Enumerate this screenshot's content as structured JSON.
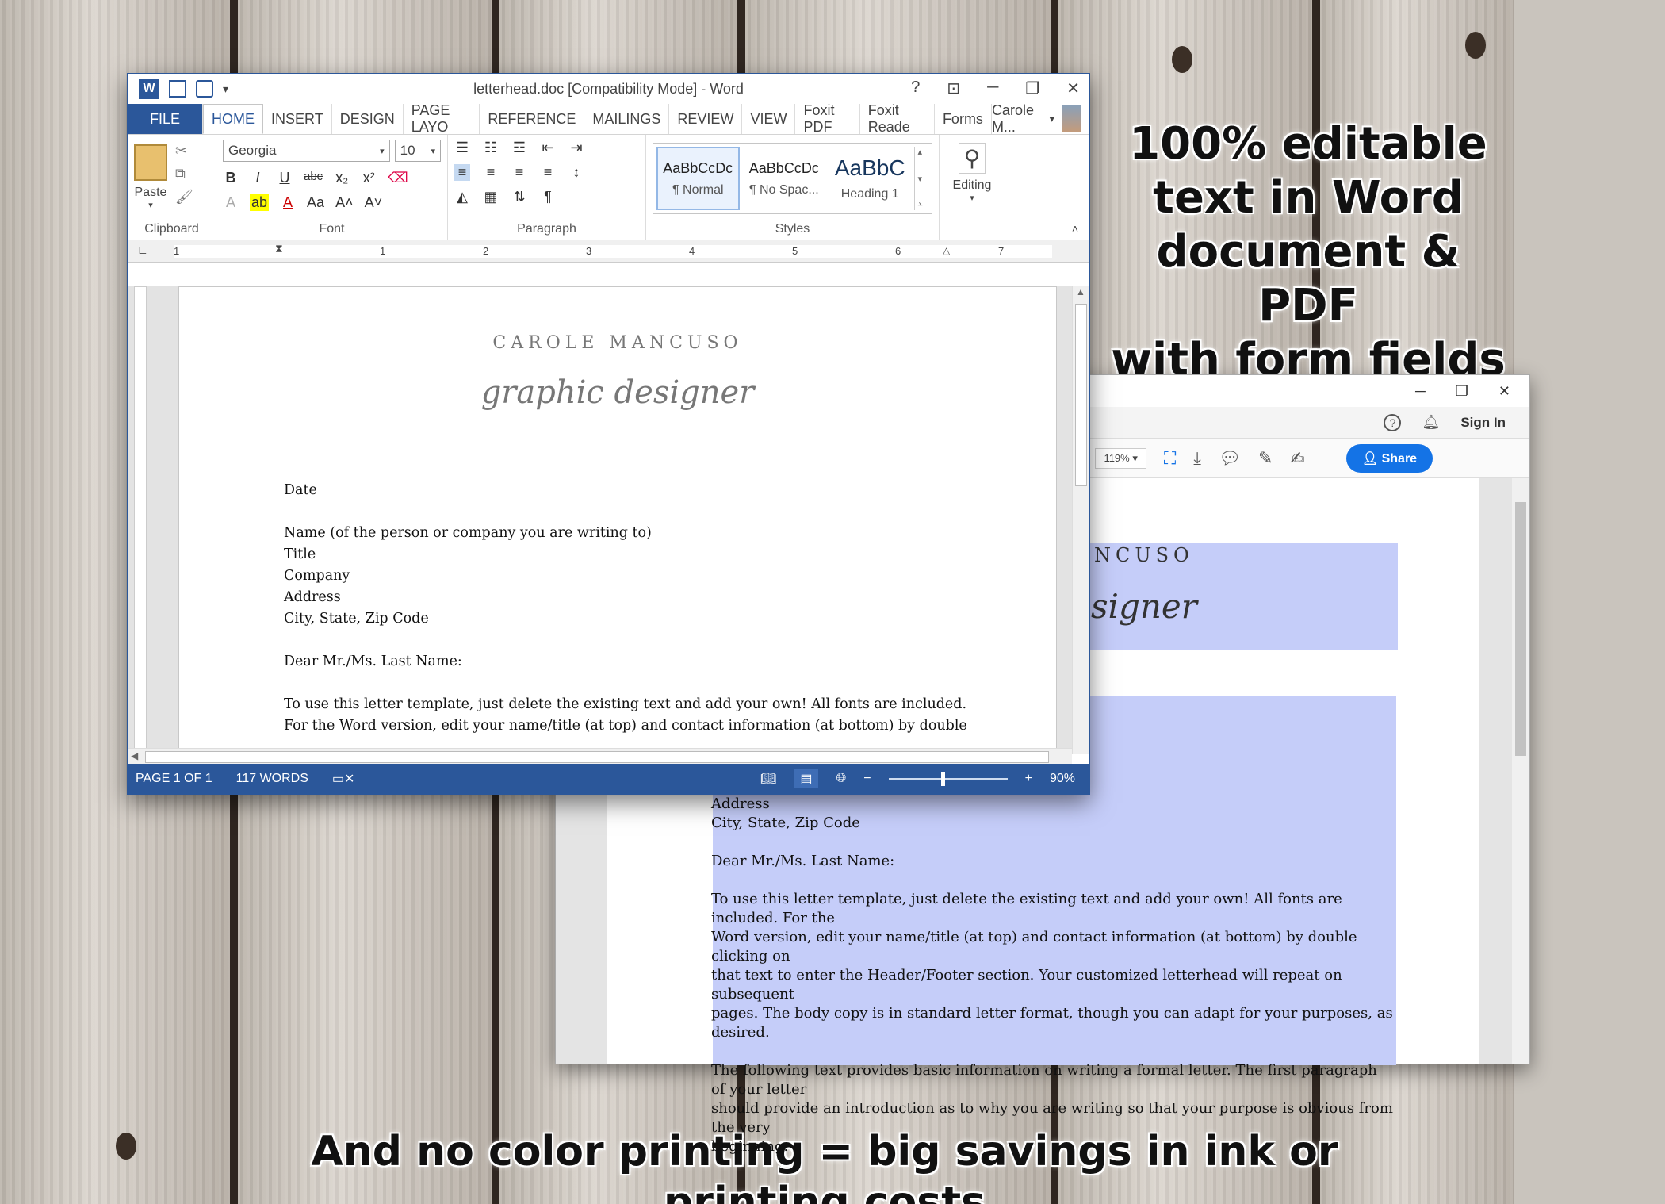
{
  "promo": {
    "right_lines": [
      "100% editable",
      "text in Word",
      "document & PDF",
      "with form fields"
    ],
    "bottom": "And no color printing = big savings in ink or printing costs"
  },
  "word": {
    "title": "letterhead.doc [Compatibility Mode] - Word",
    "tabs": [
      "FILE",
      "HOME",
      "INSERT",
      "DESIGN",
      "PAGE LAYO",
      "REFERENCE",
      "MAILINGS",
      "REVIEW",
      "VIEW",
      "Foxit PDF",
      "Foxit Reade",
      "Forms"
    ],
    "active_tab": "HOME",
    "user": "Carole M...",
    "ribbon": {
      "paste_label": "Paste",
      "font_name": "Georgia",
      "font_size": "10",
      "groups": [
        "Clipboard",
        "Font",
        "Paragraph",
        "Styles"
      ],
      "styles": [
        {
          "preview": "AaBbCcDc",
          "name": "¶ Normal"
        },
        {
          "preview": "AaBbCcDc",
          "name": "¶ No Spac..."
        },
        {
          "preview": "AaBbC",
          "name": "Heading 1"
        }
      ],
      "editing_label": "Editing"
    },
    "ruler_numbers": [
      "1",
      "1",
      "2",
      "3",
      "4",
      "5",
      "6",
      "7"
    ],
    "letterhead_name": "CAROLE MANCUSO",
    "letterhead_script": "graphic designer",
    "body": {
      "date": "Date",
      "name": "Name (of the person or company you are writing to)",
      "title": "Title",
      "company": "Company",
      "address": "Address",
      "city": "City, State, Zip Code",
      "greeting": "Dear Mr./Ms. Last Name:",
      "para1_line1": "To use this letter template, just delete the existing text and add your own!  All fonts are included.",
      "para1_line2": "For the Word version, edit your name/title (at top) and contact information (at bottom) by double"
    },
    "status": {
      "page": "PAGE 1 OF 1",
      "words": "117 WORDS",
      "zoom": "90%"
    }
  },
  "pdf": {
    "signin": "Sign In",
    "zoom": "119%",
    "share": "Share",
    "header_fragment": "NCUSO",
    "script_fragment": "signer",
    "lines": [
      "Address",
      "City, State, Zip Code",
      "",
      "Dear Mr./Ms. Last Name:",
      "",
      "To use this letter template, just delete the existing text and add your own!  All fonts are included.  For the",
      "Word version, edit your name/title (at top) and contact information (at bottom) by double clicking on",
      "that text to enter the Header/Footer section.  Your customized letterhead will repeat on subsequent",
      "pages.  The body copy is in standard letter format, though you can adapt for your purposes, as desired.",
      "",
      "The following text provides basic information on writing a formal letter.  The first paragraph of your letter",
      "should provide an introduction as to why you are writing so that your purpose is obvious from the very",
      "beginning."
    ]
  }
}
